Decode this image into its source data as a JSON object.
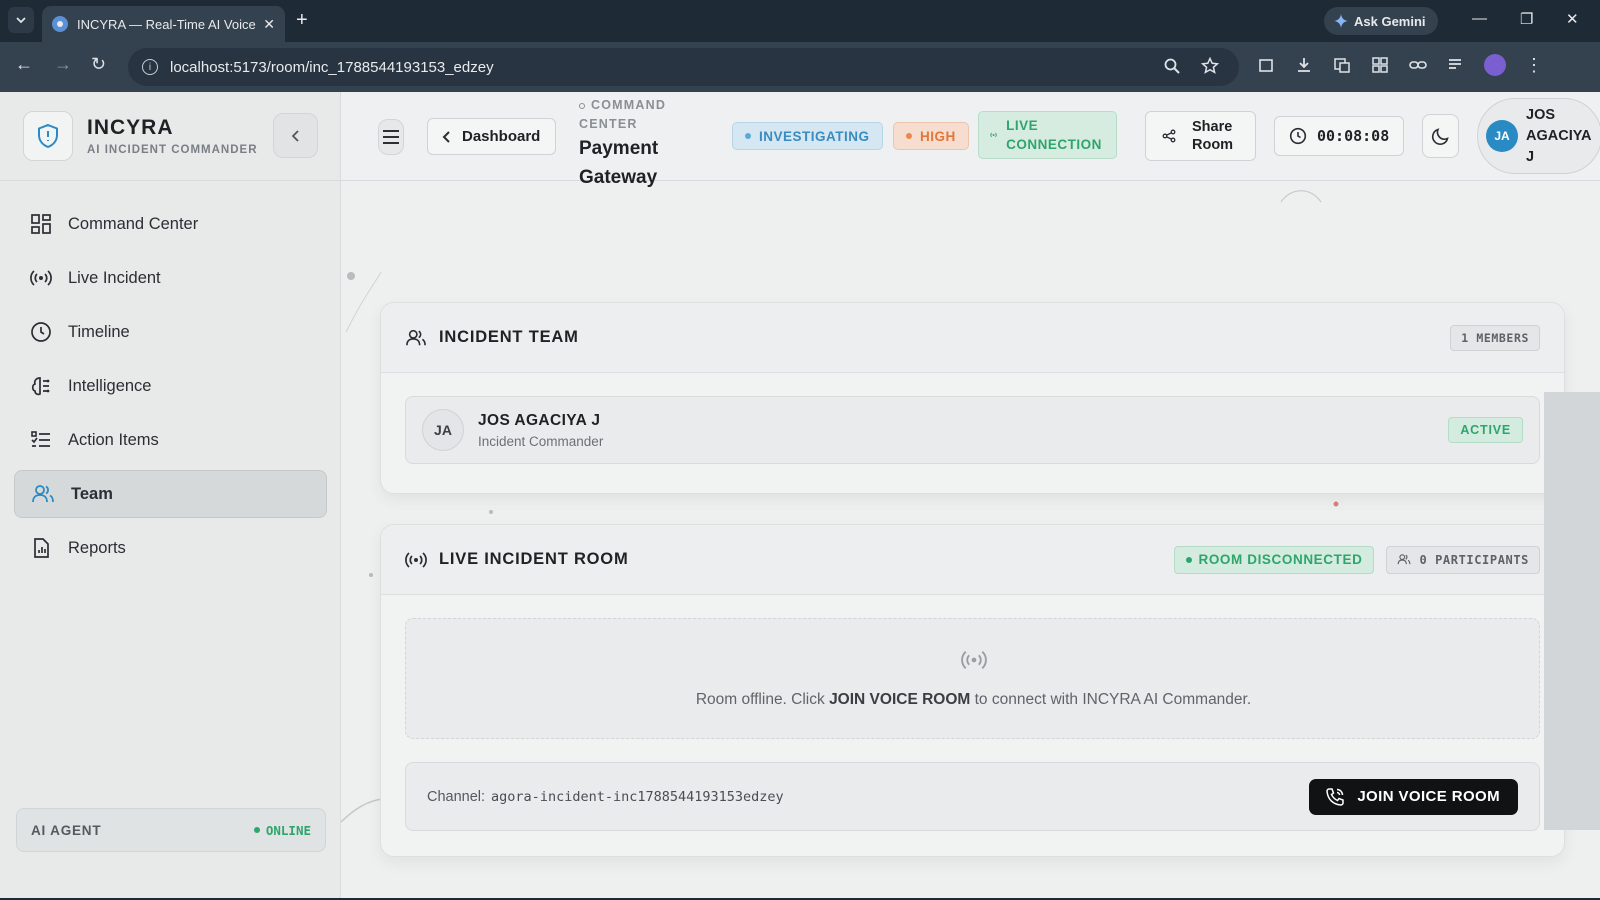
{
  "browser": {
    "tab_title": "INCYRA — Real-Time AI Voice I",
    "new_tab_label": "+",
    "gemini_label": "Ask Gemini",
    "url": "localhost:5173/room/inc_1788544193153_edzey"
  },
  "brand": {
    "name": "INCYRA",
    "subtitle": "AI INCIDENT COMMANDER"
  },
  "sidebar": {
    "items": [
      {
        "label": "Command Center",
        "icon": "grid-icon"
      },
      {
        "label": "Live Incident",
        "icon": "broadcast-icon"
      },
      {
        "label": "Timeline",
        "icon": "clock-icon"
      },
      {
        "label": "Intelligence",
        "icon": "brain-icon"
      },
      {
        "label": "Action Items",
        "icon": "checklist-icon"
      },
      {
        "label": "Team",
        "icon": "users-icon",
        "active": true
      },
      {
        "label": "Reports",
        "icon": "report-icon"
      }
    ],
    "agent_label": "AI AGENT",
    "agent_status": "ONLINE"
  },
  "header": {
    "dashboard_label": "Dashboard",
    "section_label": "INCIDENT COMMAND CENTER",
    "section_label_visible": "COMMAND CENTER",
    "incident_title": "Payment Gateway",
    "status": "INVESTIGATING",
    "severity": "HIGH",
    "connection": "LIVE CONNECTION",
    "share_label": "Share Room",
    "timer": "00:08:08",
    "user_initials": "JA",
    "user_name": "JOS AGACIYA J"
  },
  "team": {
    "title": "INCIDENT TEAM",
    "members_count": "1 MEMBERS",
    "members": [
      {
        "initials": "JA",
        "name": "JOS AGACIYA J",
        "role": "Incident Commander",
        "status": "ACTIVE"
      }
    ]
  },
  "room": {
    "title": "LIVE INCIDENT ROOM",
    "status": "ROOM DISCONNECTED",
    "participants": "0 PARTICIPANTS",
    "offline_prefix": "Room offline. Click ",
    "offline_action": "JOIN VOICE ROOM",
    "offline_suffix": " to connect with INCYRA AI Commander.",
    "channel_label": "Channel:",
    "channel_value": "agora-incident-inc1788544193153edzey",
    "join_label": "JOIN VOICE ROOM"
  },
  "colors": {
    "accent_green": "#2fa56c",
    "accent_blue": "#3a8bbf",
    "accent_orange": "#e2773a",
    "browser_dark": "#1f2a37"
  }
}
